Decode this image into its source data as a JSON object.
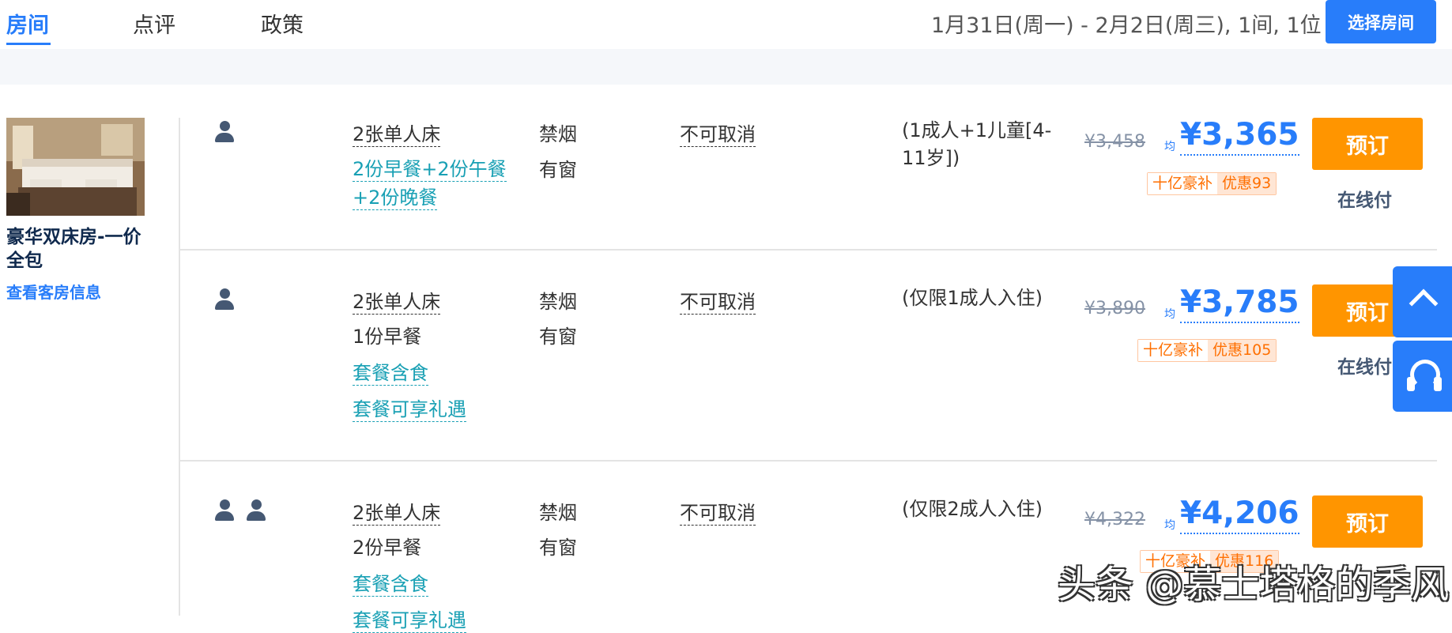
{
  "nav": {
    "tabs": [
      {
        "label": "房间"
      },
      {
        "label": "点评"
      },
      {
        "label": "政策"
      }
    ],
    "date_info": "1月31日(周一) - 2月2日(周三), 1间, 1位",
    "select_room_button": "选择房间"
  },
  "room": {
    "title": "豪华双床房-一价全包",
    "info_link": "查看客房信息"
  },
  "rates": [
    {
      "bed": "2张单人床",
      "meal_lines": [
        "2份早餐+2份午餐",
        "+2份晚餐"
      ],
      "smoking": "禁烟",
      "window": "有窗",
      "cancel": "不可取消",
      "occupancy": "(1成人+1儿童[4-11岁])",
      "original_price": "¥3,458",
      "avg_label": "均",
      "price": "¥3,365",
      "promo_label": "十亿豪补",
      "promo_value": "优惠93",
      "book_button": "预订",
      "payment": "在线付"
    },
    {
      "bed": "2张单人床",
      "meal": "1份早餐",
      "package_meal": "套餐含食",
      "package_perk": "套餐可享礼遇",
      "smoking": "禁烟",
      "window": "有窗",
      "cancel": "不可取消",
      "occupancy": "(仅限1成人入住)",
      "original_price": "¥3,890",
      "avg_label": "均",
      "price": "¥3,785",
      "promo_label": "十亿豪补",
      "promo_value": "优惠105",
      "book_button": "预订",
      "payment": "在线付"
    },
    {
      "bed": "2张单人床",
      "meal": "2份早餐",
      "package_meal": "套餐含食",
      "package_perk": "套餐可享礼遇",
      "smoking": "禁烟",
      "window": "有窗",
      "cancel": "不可取消",
      "occupancy": "(仅限2成人入住)",
      "original_price": "¥4,322",
      "avg_label": "均",
      "price": "¥4,206",
      "promo_label": "十亿豪补",
      "promo_value": "优惠116",
      "book_button": "预订"
    }
  ],
  "side_buttons": {
    "top_icon": "chevron-up-icon",
    "service_icon": "headset-icon"
  },
  "watermark": "头条 @慕士塔格的季风",
  "colors": {
    "primary_blue": "#287dfa",
    "book_orange": "#ff9500",
    "teal_link": "#19a0b4",
    "promo_orange": "#ff6f00"
  }
}
